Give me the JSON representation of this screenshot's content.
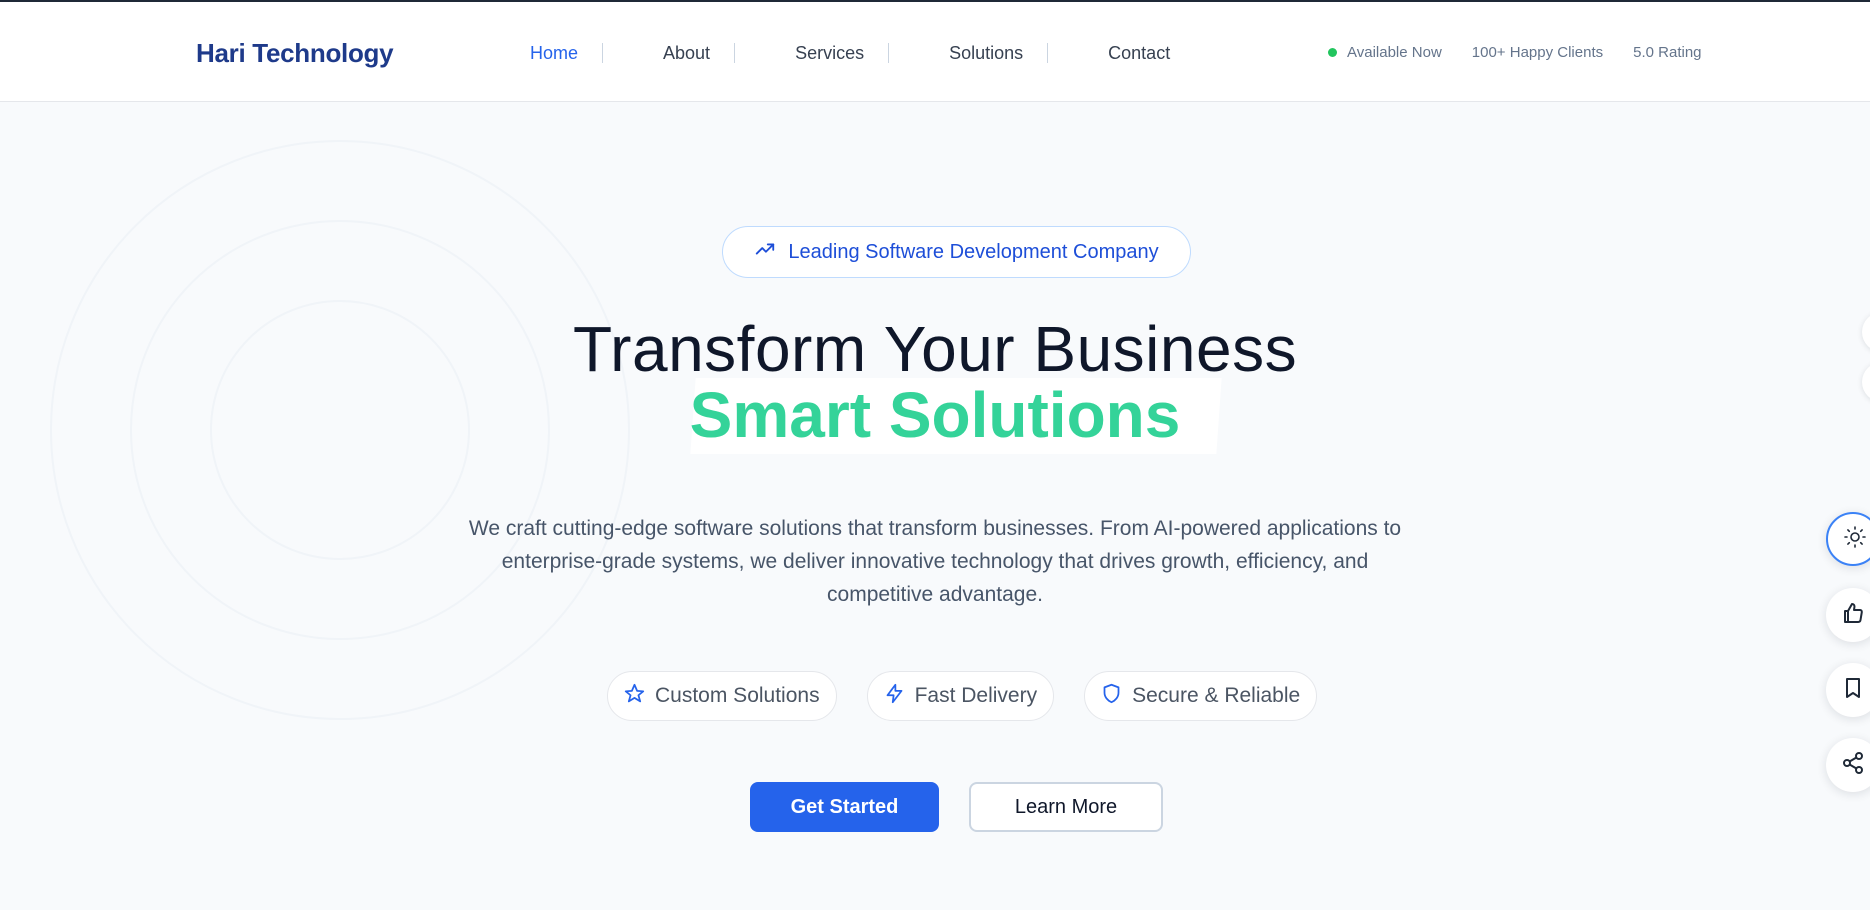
{
  "brand": {
    "name": "Hari Technology"
  },
  "nav": {
    "items": [
      {
        "label": "Home",
        "active": true
      },
      {
        "label": "About",
        "active": false
      },
      {
        "label": "Services",
        "active": false
      },
      {
        "label": "Solutions",
        "active": false
      },
      {
        "label": "Contact",
        "active": false
      }
    ]
  },
  "status": {
    "availability": "Available Now",
    "clients": "100+ Happy Clients",
    "rating": "5.0 Rating"
  },
  "hero": {
    "badge": {
      "icon": "trending-up-icon",
      "text": "Leading Software Development Company"
    },
    "title_line1": "Transform Your Business",
    "title_line2": "Smart Solutions",
    "description": "We craft cutting-edge software solutions that transform businesses. From AI-powered applications to enterprise-grade systems, we deliver innovative technology that drives growth, efficiency, and competitive advantage.",
    "features": [
      {
        "icon": "star-icon",
        "label": "Custom Solutions"
      },
      {
        "icon": "lightning-icon",
        "label": "Fast Delivery"
      },
      {
        "icon": "shield-icon",
        "label": "Secure & Reliable"
      }
    ],
    "primary_cta": "Get Started",
    "secondary_cta": "Learn More"
  },
  "floating_actions": [
    {
      "icon": "sun-icon",
      "label": "theme-toggle"
    },
    {
      "icon": "thumbs-up-icon",
      "label": "like"
    },
    {
      "icon": "bookmark-icon",
      "label": "bookmark"
    },
    {
      "icon": "share-icon",
      "label": "share"
    }
  ],
  "colors": {
    "brand": "#1e3a8a",
    "accent": "#2563eb",
    "highlight": "#34d399",
    "status_online": "#22c55e"
  }
}
